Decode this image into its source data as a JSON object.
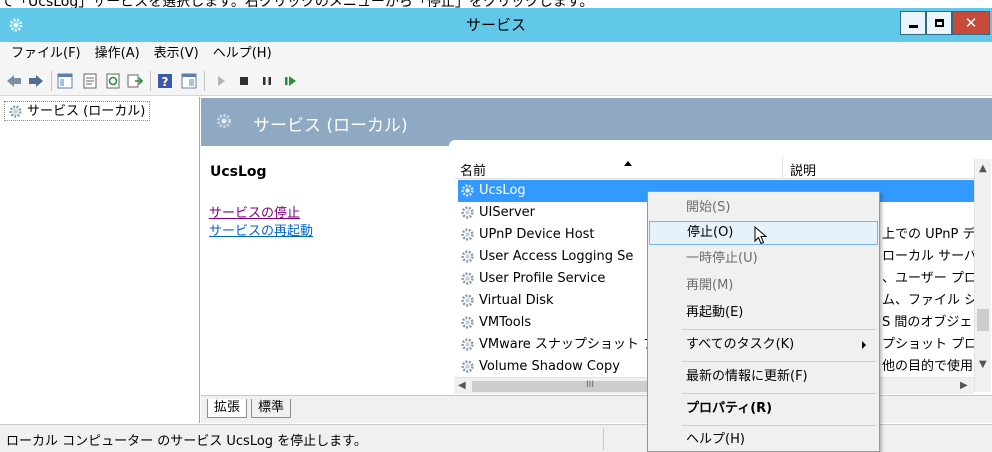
{
  "caption_fragment": "て「UcsLog」サービスを選択します。右クリックのメニューから「停止」をクリックします。",
  "window": {
    "title": "サービス"
  },
  "menubar": [
    "ファイル(F)",
    "操作(A)",
    "表示(V)",
    "ヘルプ(H)"
  ],
  "toolbar": {
    "icons": [
      "back-arrow-icon",
      "forward-arrow-icon",
      "console-tree-icon",
      "properties-icon",
      "refresh-icon",
      "export-list-icon",
      "help-icon",
      "view-icon",
      "start-service-icon",
      "stop-service-icon",
      "pause-service-icon",
      "resume-service-icon"
    ]
  },
  "tree": {
    "item": "サービス (ローカル)"
  },
  "header": {
    "title": "サービス (ローカル)"
  },
  "detail": {
    "service_name": "UcsLog",
    "links": [
      "サービスの停止",
      "サービスの再起動"
    ]
  },
  "list": {
    "columns": [
      "名前",
      "説明"
    ],
    "rows": [
      {
        "name": "UcsLog",
        "desc": "",
        "selected": true
      },
      {
        "name": "UIServer",
        "desc": ""
      },
      {
        "name": "UPnP Device Host",
        "desc": "上での UPnP デ"
      },
      {
        "name": "User Access Logging Se",
        "desc": "ローカル サーバ"
      },
      {
        "name": "User Profile Service",
        "desc": "、ユーザー プロフ"
      },
      {
        "name": "Virtual Disk",
        "desc": "ム、ファイル システ"
      },
      {
        "name": "VMTools",
        "desc": "S 間のオブジェクト"
      },
      {
        "name": "VMware スナップショット プロ",
        "desc": "プショット プロバイ"
      },
      {
        "name": "Volume Shadow Copy",
        "desc": "他の目的で使用"
      }
    ],
    "hscroll_glyph": "III"
  },
  "tabs": [
    "拡張",
    "標準"
  ],
  "status": {
    "text": "ローカル コンピューター のサービス UcsLog を停止します。"
  },
  "context_menu": {
    "items": [
      {
        "label": "開始(S)",
        "state": "disabled"
      },
      {
        "label": "停止(O)",
        "state": "hover"
      },
      {
        "label": "一時停止(U)",
        "state": "disabled"
      },
      {
        "label": "再開(M)",
        "state": "disabled"
      },
      {
        "label": "再起動(E)",
        "state": "normal"
      },
      {
        "label": "すべてのタスク(K)",
        "state": "submenu"
      },
      {
        "label": "最新の情報に更新(F)",
        "state": "normal"
      },
      {
        "label": "プロパティ(R)",
        "state": "bold"
      },
      {
        "label": "ヘルプ(H)",
        "state": "normal"
      }
    ]
  },
  "colors": {
    "titlebar": "#62c8ea",
    "header_band": "#8fa9c3",
    "selection": "#3399ff",
    "visited_link": "#800080",
    "link": "#0066cc",
    "menu_hover": "#e5f1fb"
  }
}
